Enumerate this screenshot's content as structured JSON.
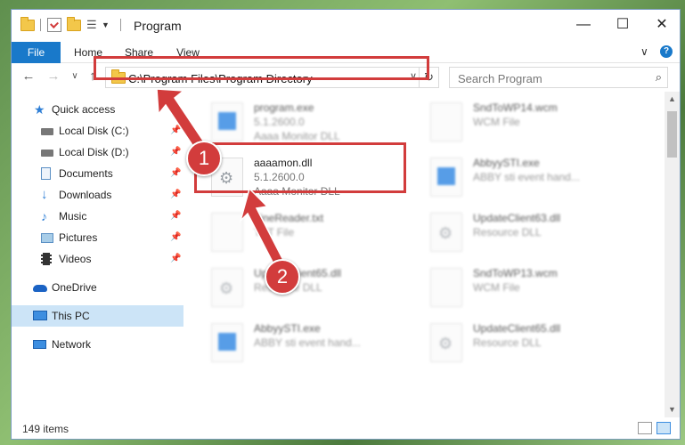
{
  "window": {
    "title": "Program",
    "controls": {
      "minimize": "—",
      "maximize": "☐",
      "close": "✕"
    }
  },
  "ribbon": {
    "tabs": [
      "File",
      "Home",
      "Share",
      "View"
    ],
    "expand": "∨",
    "help": "?"
  },
  "nav": {
    "back": "←",
    "forward": "→",
    "recent": "∨",
    "up": "↑",
    "address": "C:\\Program Files\\Program Directory",
    "address_dropdown": "∨",
    "refresh": "↻",
    "search_placeholder": "Search Program",
    "search_icon": "⌕"
  },
  "sidebar": {
    "items": [
      {
        "label": "Quick access",
        "icon": "star-icon",
        "pinned": false
      },
      {
        "label": "Local Disk (C:)",
        "icon": "drive-icon",
        "pinned": true
      },
      {
        "label": "Local Disk (D:)",
        "icon": "drive-icon",
        "pinned": true
      },
      {
        "label": "Documents",
        "icon": "documents-icon",
        "pinned": true
      },
      {
        "label": "Downloads",
        "icon": "download-icon",
        "pinned": true
      },
      {
        "label": "Music",
        "icon": "music-icon",
        "pinned": true
      },
      {
        "label": "Pictures",
        "icon": "pictures-icon",
        "pinned": true
      },
      {
        "label": "Videos",
        "icon": "videos-icon",
        "pinned": true
      },
      {
        "label": "OneDrive",
        "icon": "cloud-icon",
        "pinned": false
      },
      {
        "label": "This PC",
        "icon": "computer-icon",
        "pinned": false,
        "selected": true
      },
      {
        "label": "Network",
        "icon": "network-icon",
        "pinned": false
      }
    ],
    "pin_glyph": "📌"
  },
  "files": [
    {
      "name": "program.exe",
      "line2": "5.1.2600.0",
      "line3": "Aaaa Monitor DLL",
      "thumb": "blue",
      "blurred": true
    },
    {
      "name": "SndToWP14.wcm",
      "line2": "WCM File",
      "line3": "",
      "thumb": "blank",
      "blurred": true
    },
    {
      "name": "aaaamon.dll",
      "line2": "5.1.2600.0",
      "line3": "Aaaa Monitor DLL",
      "thumb": "gear",
      "blurred": false
    },
    {
      "name": "AbbyySTI.exe",
      "line2": "ABBY sti event hand...",
      "line3": "",
      "thumb": "blue",
      "blurred": true
    },
    {
      "name": "FineReader.txt",
      "line2": "TXT File",
      "line3": "",
      "thumb": "blank",
      "blurred": true
    },
    {
      "name": "UpdateClient63.dll",
      "line2": "Resource DLL",
      "line3": "",
      "thumb": "gear",
      "blurred": true
    },
    {
      "name": "UpdateClient65.dll",
      "line2": "Resource DLL",
      "line3": "",
      "thumb": "gear",
      "blurred": true
    },
    {
      "name": "SndToWP13.wcm",
      "line2": "WCM File",
      "line3": "",
      "thumb": "blank",
      "blurred": true
    },
    {
      "name": "AbbyySTI.exe",
      "line2": "ABBY sti event hand...",
      "line3": "",
      "thumb": "blue",
      "blurred": true
    },
    {
      "name": "UpdateClient65.dll",
      "line2": "Resource DLL",
      "line3": "",
      "thumb": "gear",
      "blurred": true
    }
  ],
  "status": {
    "count": "149 items"
  },
  "annotations": {
    "step1": "1",
    "step2": "2",
    "color": "#d23c3c"
  }
}
